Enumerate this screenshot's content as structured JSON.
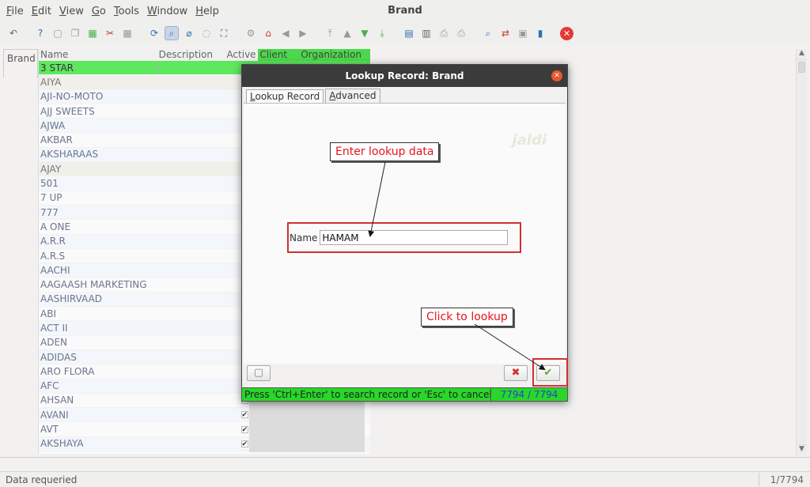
{
  "window": {
    "title": "Brand"
  },
  "menu": [
    "File",
    "Edit",
    "View",
    "Go",
    "Tools",
    "Window",
    "Help"
  ],
  "toolbar_icons": [
    "undo-icon",
    "help-icon",
    "new-icon",
    "copy-icon",
    "save-icon",
    "delete-icon",
    "ignore-icon",
    "refresh-icon",
    "find-icon",
    "attachment-icon",
    "chat-icon",
    "fullscreen-icon",
    "home-icon",
    "back-icon",
    "forward-icon",
    "first-icon",
    "previous-icon",
    "next-icon",
    "last-icon",
    "report-icon",
    "archive-icon",
    "print-icon",
    "print-preview-icon",
    "zoom-icon",
    "workflow-icon",
    "product-icon",
    "window-icon",
    "exit-icon"
  ],
  "tab": {
    "brand": "Brand"
  },
  "grid": {
    "columns": [
      "Name",
      "Description",
      "Active",
      "Client",
      "Organization"
    ],
    "rows": [
      {
        "name": "3 STAR",
        "active": true,
        "selected": true
      },
      {
        "name": "AIYA",
        "active": false,
        "inactive_row": true
      },
      {
        "name": "AJI-NO-MOTO",
        "active": true
      },
      {
        "name": "AJJ SWEETS",
        "active": true
      },
      {
        "name": "AJWA",
        "active": true
      },
      {
        "name": "AKBAR",
        "active": true
      },
      {
        "name": "AKSHARAAS",
        "active": true
      },
      {
        "name": "AJAY",
        "active": false,
        "inactive_row": true
      },
      {
        "name": "501",
        "active": true
      },
      {
        "name": "7 UP",
        "active": true
      },
      {
        "name": "777",
        "active": true
      },
      {
        "name": "A ONE",
        "active": true
      },
      {
        "name": "A.R.R",
        "active": true
      },
      {
        "name": "A.R.S",
        "active": true
      },
      {
        "name": "AACHI",
        "active": true
      },
      {
        "name": "AAGAASH MARKETING",
        "active": true
      },
      {
        "name": "AASHIRVAAD",
        "active": true
      },
      {
        "name": "ABI",
        "active": true
      },
      {
        "name": "ACT II",
        "active": true
      },
      {
        "name": "ADEN",
        "active": true
      },
      {
        "name": "ADIDAS",
        "active": true
      },
      {
        "name": "ARO FLORA",
        "active": true
      },
      {
        "name": "AFC",
        "active": true
      },
      {
        "name": "AHSAN",
        "active": true
      },
      {
        "name": "AVANI",
        "active": true
      },
      {
        "name": "AVT",
        "active": true
      },
      {
        "name": "AKSHAYA",
        "active": true
      }
    ]
  },
  "status": {
    "text": "Data requeried",
    "count": "1/7794"
  },
  "dialog": {
    "title": "Lookup Record: Brand",
    "tabs": [
      "Lookup Record",
      "Advanced"
    ],
    "watermark": "jaldi",
    "name_label": "Name",
    "name_value": "HAMAM",
    "status_message": "Press 'Ctrl+Enter' to search record or 'Esc' to cancel",
    "record_count": "7794 / 7794"
  },
  "annotations": {
    "enter_lookup": "Enter lookup data",
    "click_lookup": "Click to lookup"
  },
  "colors": {
    "selected_row": "#5ee85e",
    "status_green": "#28d728",
    "annotation_red": "#e4141b"
  }
}
